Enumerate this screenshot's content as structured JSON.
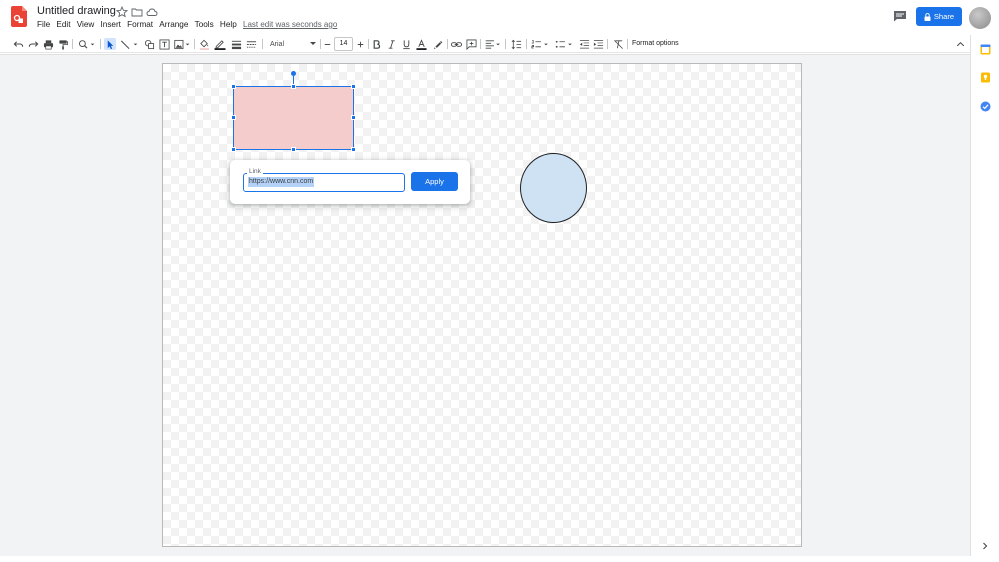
{
  "header": {
    "title": "Untitled drawing",
    "menu": [
      "File",
      "Edit",
      "View",
      "Insert",
      "Format",
      "Arrange",
      "Tools",
      "Help"
    ],
    "last_edit": "Last edit was seconds ago",
    "share_label": "Share"
  },
  "toolbar": {
    "font": "Arial",
    "font_size": "14",
    "format_options": "Format options"
  },
  "link_popup": {
    "label": "Link",
    "value": "https://www.cnn.com",
    "apply_label": "Apply"
  },
  "colors": {
    "accent": "#1a73e8",
    "rect_fill": "#f4cccc",
    "circle_fill": "#cfe2f3",
    "logo": "#ea4335"
  },
  "icons": {
    "logo": "drawings-logo-icon",
    "star": "star-icon",
    "folder": "move-folder-icon",
    "cloud": "cloud-status-icon",
    "comments": "comments-icon",
    "lock": "lock-icon"
  }
}
